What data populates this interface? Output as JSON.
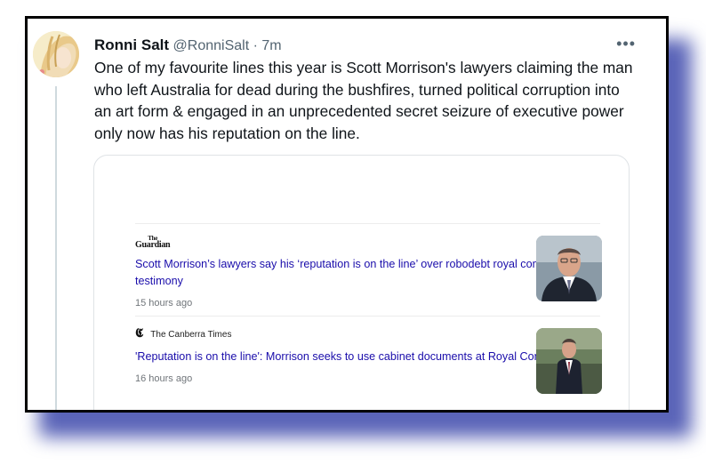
{
  "tweet": {
    "name": "Ronni Salt",
    "handle": "@RonniSalt",
    "separator": "·",
    "time": "7m",
    "more_icon": "more-horizontal-icon",
    "text": "One of my favourite lines this year is Scott Morrison's lawyers claiming the man who left Australia for dead during the bushfires, turned political corruption into an art form & engaged in an unprecedented secret seizure of executive power only now has his reputation on the line."
  },
  "card": {
    "articles": [
      {
        "source_logo_line1": "The",
        "source_logo_line2": "Guardian",
        "headline": "Scott Morrison’s lawyers say his ‘reputation is on the line’ over robodebt royal commission testimony",
        "age": "15 hours ago"
      },
      {
        "source_logo_icon": "canberra-times-logo-icon",
        "source_name": "The Canberra Times",
        "headline": "'Reputation is on the line': Morrison seeks to use cabinet documents at Royal Commission",
        "age": "16 hours ago"
      }
    ]
  },
  "colors": {
    "frame": "#000000",
    "shadow": "#5a64b8",
    "headline_link": "#1a0dab",
    "muted": "#536471"
  }
}
